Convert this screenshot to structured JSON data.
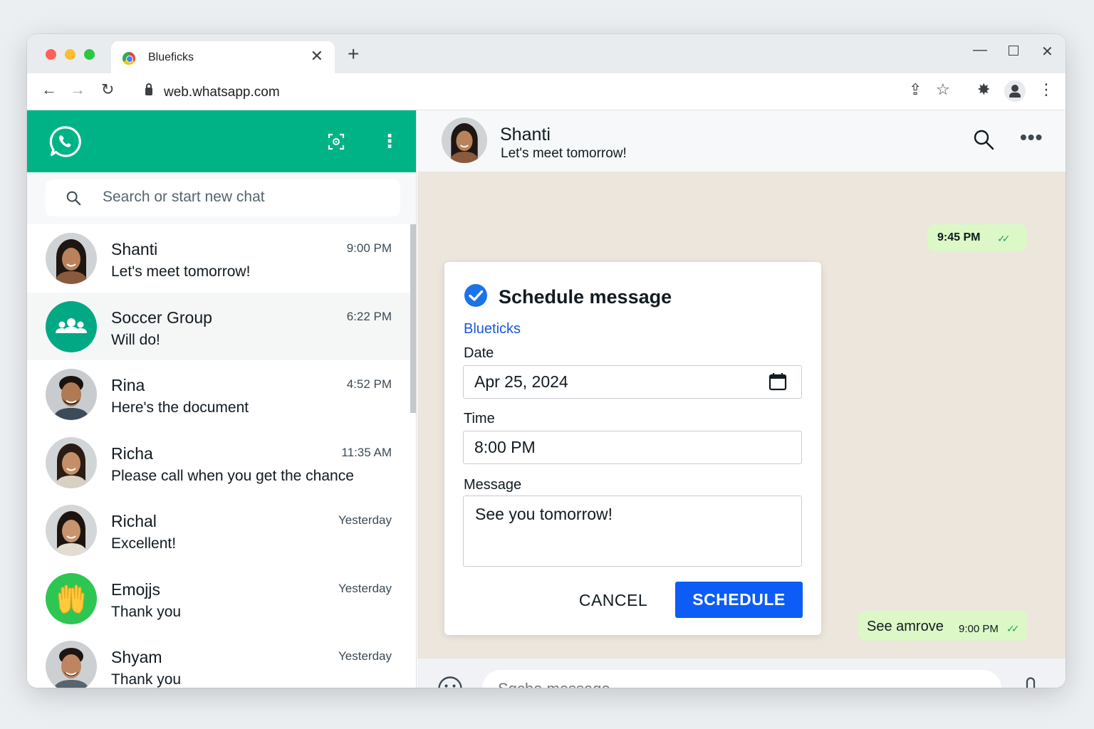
{
  "browser": {
    "tab_title": "Blueficks",
    "tab_close": "✕",
    "new_tab": "+",
    "url": "web.whatsapp.com",
    "win_min": "—",
    "win_close": "✕",
    "nav_back": "←",
    "nav_forward": "→",
    "nav_reload": "↻",
    "share_glyph": "⇪",
    "star_glyph": "☆",
    "extension_glyph": "✸",
    "menu_glyph": "⋮"
  },
  "sidebar": {
    "search_placeholder": "Search or start new chat",
    "menu_glyph": "⋮",
    "chats": [
      {
        "name": "Shanti",
        "time": "9:00 PM",
        "preview": "Let's meet tomorrow!",
        "avatar": "woman-photo",
        "active": false
      },
      {
        "name": "Soccer Group",
        "time": "6:22 PM",
        "preview": "Will do!",
        "avatar": "group-icon",
        "active": true
      },
      {
        "name": "Rina",
        "time": "4:52 PM",
        "preview": "Here's the document",
        "avatar": "man-photo",
        "active": false
      },
      {
        "name": "Richa",
        "time": "11:35 AM",
        "preview": "Please call when you get the chance",
        "avatar": "woman-photo",
        "active": false
      },
      {
        "name": "Richal",
        "time": "Yesterday",
        "preview": "Excellent!",
        "avatar": "woman-photo",
        "active": false
      },
      {
        "name": "Emojjs",
        "time": "Yesterday",
        "preview": "Thank you",
        "avatar": "hands-emoji",
        "active": false
      },
      {
        "name": "Shyam",
        "time": "Yesterday",
        "preview": "Thank you",
        "avatar": "man-photo",
        "active": false
      }
    ]
  },
  "conversation": {
    "name": "Shanti",
    "status": "Let's meet tomorrow!",
    "more_glyph": "•••",
    "bubble_top_time": "9:45 PM",
    "ticks": "✓✓",
    "bubble_bottom_text": "See amrove",
    "bubble_bottom_time": "9:00 PM",
    "composer_placeholder": "Sqche message"
  },
  "dialog": {
    "title": "Schedule message",
    "brand": "Blueticks",
    "date_label": "Date",
    "date_value": "Apr 25, 2024",
    "time_label": "Time",
    "time_value": "8:00 PM",
    "message_label": "Message",
    "message_value": "See you tomorrow!",
    "cancel_label": "CANCEL",
    "schedule_label": "SCHEDULE"
  },
  "colors": {
    "whatsapp_green": "#00b386",
    "chat_bg": "#ede6dd",
    "bubble_green": "#dcf8c6",
    "schedule_blue": "#0d5cf5",
    "brand_blue": "#1a56db"
  }
}
